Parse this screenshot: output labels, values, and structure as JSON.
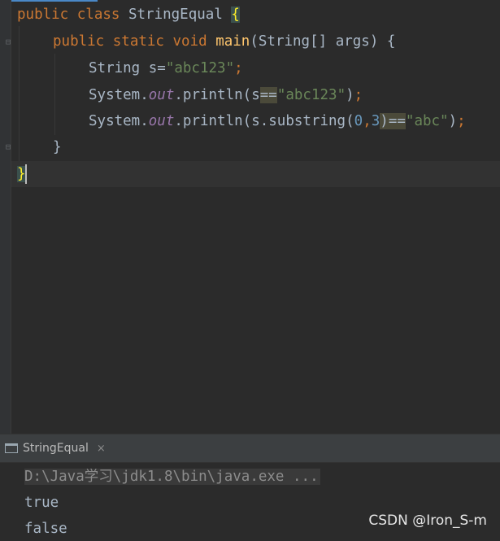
{
  "editor": {
    "lines": [
      {
        "kw1": "public class ",
        "name": "StringEqual ",
        "brace": "{"
      },
      {
        "kw1": "public static void ",
        "fn": "main",
        "rest": "(String[] args) {"
      },
      {
        "type": "String s=",
        "str": "\"abc123\"",
        "semi": ";"
      },
      {
        "pre": "System.",
        "field": "out",
        "mid": ".println(s",
        "eq": "==",
        "str": "\"abc123\"",
        "close": ")",
        "semi": ";"
      },
      {
        "pre": "System.",
        "field": "out",
        "mid": ".println(s.substring(",
        "n1": "0",
        "comma": ",",
        "n2": "3",
        "close1": ")",
        "eq": "==",
        "str": "\"abc\"",
        "close2": ")",
        "semi": ";"
      },
      {
        "text": "}"
      },
      {
        "text": "}"
      }
    ]
  },
  "run_panel": {
    "tab_label": "StringEqual",
    "tab_close": "×",
    "command": "D:\\Java学习\\jdk1.8\\bin\\java.exe ...",
    "output": [
      "true",
      "false"
    ]
  },
  "watermark": "CSDN @Iron_S-m",
  "colors": {
    "background": "#2b2b2b",
    "keyword": "#cc7832",
    "string": "#6a8759",
    "function": "#ffc66d",
    "field": "#9876aa",
    "number": "#6897bb",
    "text": "#a9b7c6"
  }
}
